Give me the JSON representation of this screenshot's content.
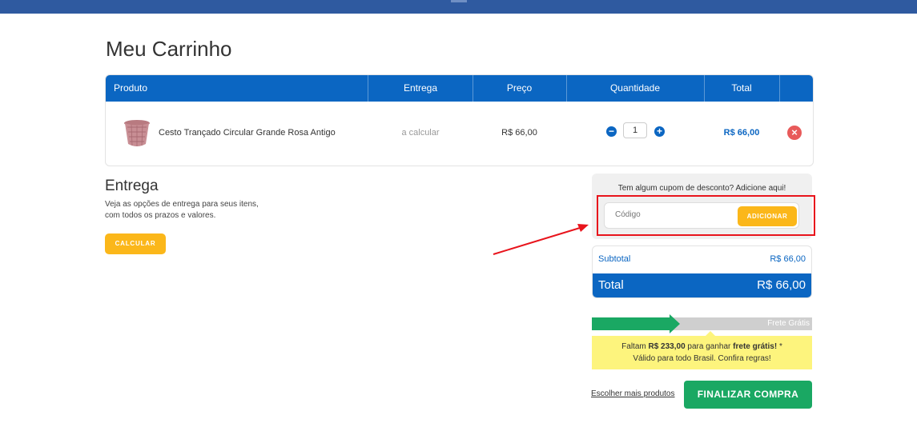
{
  "page": {
    "title": "Meu Carrinho"
  },
  "cart": {
    "headers": {
      "produto": "Produto",
      "entrega": "Entrega",
      "preco": "Preço",
      "quantidade": "Quantidade",
      "total": "Total"
    },
    "items": [
      {
        "name": "Cesto Trançado Circular Grande Rosa Antigo",
        "entrega": "a calcular",
        "preco": "R$ 66,00",
        "quantidade": "1",
        "total": "R$ 66,00",
        "icon": "basket-image"
      }
    ],
    "icons": {
      "minus": "minus-icon",
      "plus": "plus-icon",
      "remove": "close-icon"
    }
  },
  "entrega": {
    "title": "Entrega",
    "description_line1": "Veja as opções de entrega para seus itens,",
    "description_line2": "com todos os prazos e valores.",
    "button": "CALCULAR"
  },
  "coupon": {
    "prompt": "Tem algum cupom de desconto? Adicione aqui!",
    "placeholder": "Código",
    "button": "ADICIONAR"
  },
  "totals": {
    "subtotal_label": "Subtotal",
    "subtotal_value": "R$ 66,00",
    "total_label": "Total",
    "total_value": "R$ 66,00"
  },
  "frete": {
    "label": "Frete Grátis",
    "progress": 0.4,
    "msg_pre": "Faltam ",
    "msg_amount": "R$ 233,00",
    "msg_mid": " para ganhar ",
    "msg_bold": "frete grátis!",
    "msg_post": " *",
    "msg_line2": "Válido para todo Brasil. Confira regras!"
  },
  "actions": {
    "more_products": "Escolher mais produtos",
    "finish": "FINALIZAR COMPRA"
  },
  "colors": {
    "primary": "#0b66c2",
    "accent": "#fbb71a",
    "success": "#1aa863",
    "danger": "#e85a5a",
    "highlight": "#e8141c"
  }
}
